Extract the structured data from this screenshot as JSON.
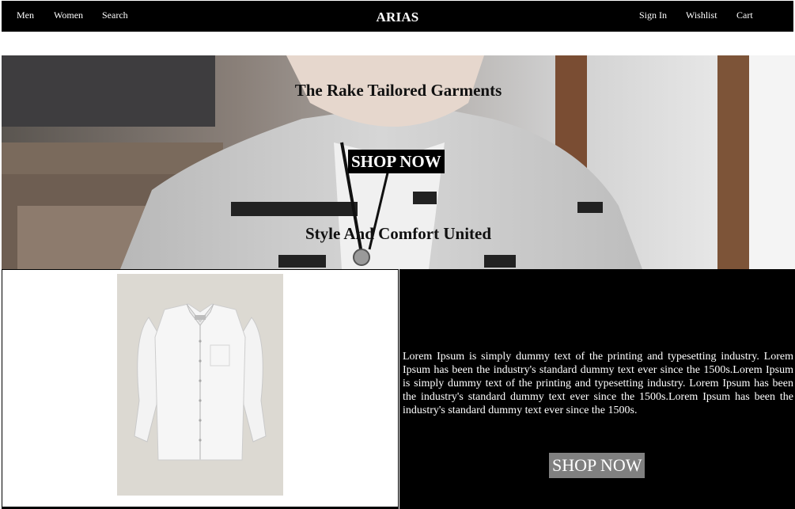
{
  "nav": {
    "left": [
      "Men",
      "Women",
      "Search"
    ],
    "brand": "ARIAS",
    "right": [
      "Sign In",
      "Wishlist",
      "Cart"
    ]
  },
  "hero": {
    "title": "The Rake Tailored Garments",
    "button": "SHOP NOW",
    "subtitle": "Style And Comfort United"
  },
  "feature": {
    "description": "Lorem Ipsum is simply dummy text of the printing and typesetting industry. Lorem Ipsum has been the industry's standard dummy text ever since the 1500s.Lorem Ipsum is simply dummy text of the printing and typesetting industry. Lorem Ipsum has been the industry's standard dummy text ever since the 1500s.Lorem Ipsum has been the industry's standard dummy text ever since the 1500s.",
    "button": "SHOP NOW"
  },
  "colors": {
    "nav_bg": "#000000",
    "info_bg": "#000000",
    "info_button_bg": "#808080",
    "product_bg": "#dcd9d2"
  }
}
